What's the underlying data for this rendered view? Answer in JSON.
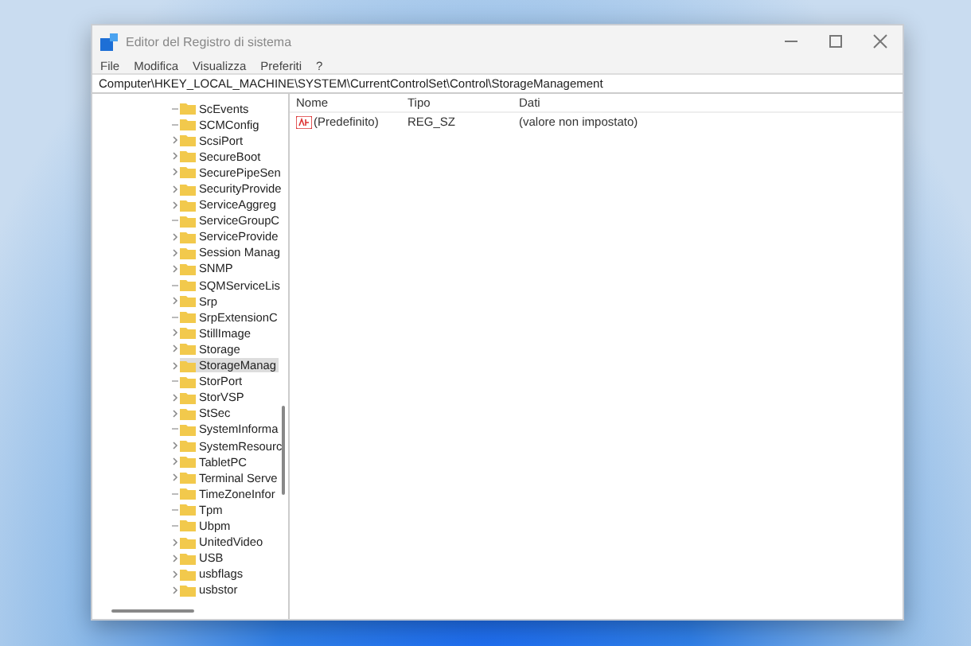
{
  "window": {
    "title": "Editor del Registro di sistema"
  },
  "menu": [
    "File",
    "Modifica",
    "Visualizza",
    "Preferiti",
    "?"
  ],
  "address": "Computer\\HKEY_LOCAL_MACHINE\\SYSTEM\\CurrentControlSet\\Control\\StorageManagement",
  "tree": [
    {
      "label": "ScEvents",
      "expandable": false,
      "selected": false
    },
    {
      "label": "SCMConfig",
      "expandable": false,
      "selected": false
    },
    {
      "label": "ScsiPort",
      "expandable": true,
      "selected": false
    },
    {
      "label": "SecureBoot",
      "expandable": true,
      "selected": false
    },
    {
      "label": "SecurePipeSen",
      "expandable": true,
      "selected": false
    },
    {
      "label": "SecurityProvide",
      "expandable": true,
      "selected": false
    },
    {
      "label": "ServiceAggreg",
      "expandable": true,
      "selected": false
    },
    {
      "label": "ServiceGroupC",
      "expandable": false,
      "selected": false
    },
    {
      "label": "ServiceProvide",
      "expandable": true,
      "selected": false
    },
    {
      "label": "Session Manag",
      "expandable": true,
      "selected": false
    },
    {
      "label": "SNMP",
      "expandable": true,
      "selected": false
    },
    {
      "label": "SQMServiceLis",
      "expandable": false,
      "selected": false
    },
    {
      "label": "Srp",
      "expandable": true,
      "selected": false
    },
    {
      "label": "SrpExtensionC",
      "expandable": false,
      "selected": false
    },
    {
      "label": "StillImage",
      "expandable": true,
      "selected": false
    },
    {
      "label": "Storage",
      "expandable": true,
      "selected": false
    },
    {
      "label": "StorageManag",
      "expandable": true,
      "selected": true
    },
    {
      "label": "StorPort",
      "expandable": false,
      "selected": false
    },
    {
      "label": "StorVSP",
      "expandable": true,
      "selected": false
    },
    {
      "label": "StSec",
      "expandable": true,
      "selected": false
    },
    {
      "label": "SystemInforma",
      "expandable": false,
      "selected": false
    },
    {
      "label": "SystemResourc",
      "expandable": true,
      "selected": false
    },
    {
      "label": "TabletPC",
      "expandable": true,
      "selected": false
    },
    {
      "label": "Terminal Serve",
      "expandable": true,
      "selected": false
    },
    {
      "label": "TimeZoneInfor",
      "expandable": false,
      "selected": false
    },
    {
      "label": "Tpm",
      "expandable": false,
      "selected": false
    },
    {
      "label": "Ubpm",
      "expandable": false,
      "selected": false
    },
    {
      "label": "UnitedVideo",
      "expandable": true,
      "selected": false
    },
    {
      "label": "USB",
      "expandable": true,
      "selected": false
    },
    {
      "label": "usbflags",
      "expandable": true,
      "selected": false
    },
    {
      "label": "usbstor",
      "expandable": true,
      "selected": false
    }
  ],
  "table": {
    "columns": [
      "Nome",
      "Tipo",
      "Dati"
    ],
    "rows": [
      {
        "name": "(Predefinito)",
        "type": "REG_SZ",
        "data": "(valore non impostato)"
      }
    ]
  }
}
